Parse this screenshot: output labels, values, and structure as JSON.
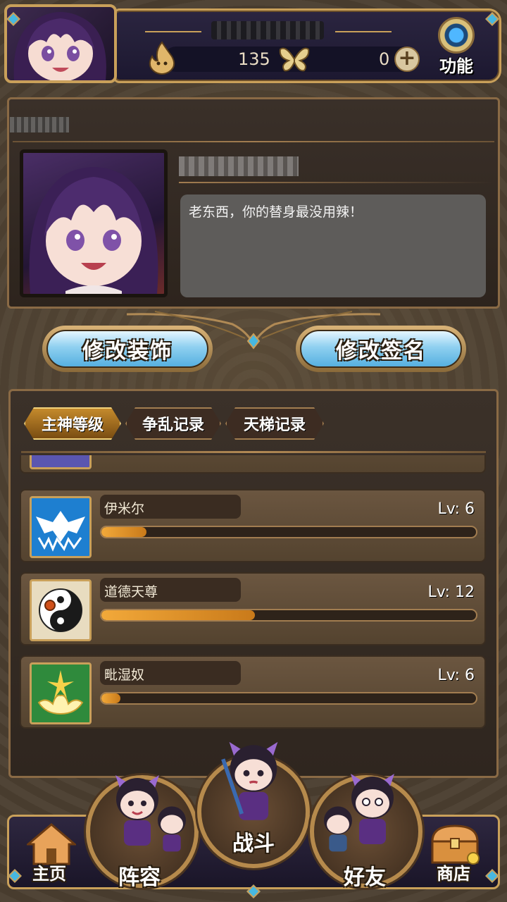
{
  "header": {
    "gold_value": "135",
    "gem_value": "0",
    "function_label": "功能"
  },
  "profile": {
    "signature": "老东西，你的替身最没用辣！"
  },
  "actions": {
    "edit_decoration": "修改装饰",
    "edit_signature": "修改签名"
  },
  "tabs": [
    {
      "label": "主神等级",
      "active": true
    },
    {
      "label": "争乱记录",
      "active": false
    },
    {
      "label": "天梯记录",
      "active": false
    }
  ],
  "god_levels": [
    {
      "name": "伊米尔",
      "level": "Lv: 6",
      "progress": 0.12,
      "icon": "ice-dragon-icon",
      "icon_color": "#1e7fd0"
    },
    {
      "name": "道德天尊",
      "level": "Lv: 12",
      "progress": 0.41,
      "icon": "yin-yang-icon",
      "icon_color": "#e8dcc0"
    },
    {
      "name": "毗湿奴",
      "level": "Lv: 6",
      "progress": 0.05,
      "icon": "lotus-icon",
      "icon_color": "#2f8a3c"
    }
  ],
  "nav": {
    "home": "主页",
    "lineup": "阵容",
    "battle": "战斗",
    "friends": "好友",
    "shop": "商店"
  },
  "colors": {
    "accent_gold": "#c9a05a",
    "button_blue": "#56b0e0",
    "progress_orange": "#f2a93a"
  }
}
